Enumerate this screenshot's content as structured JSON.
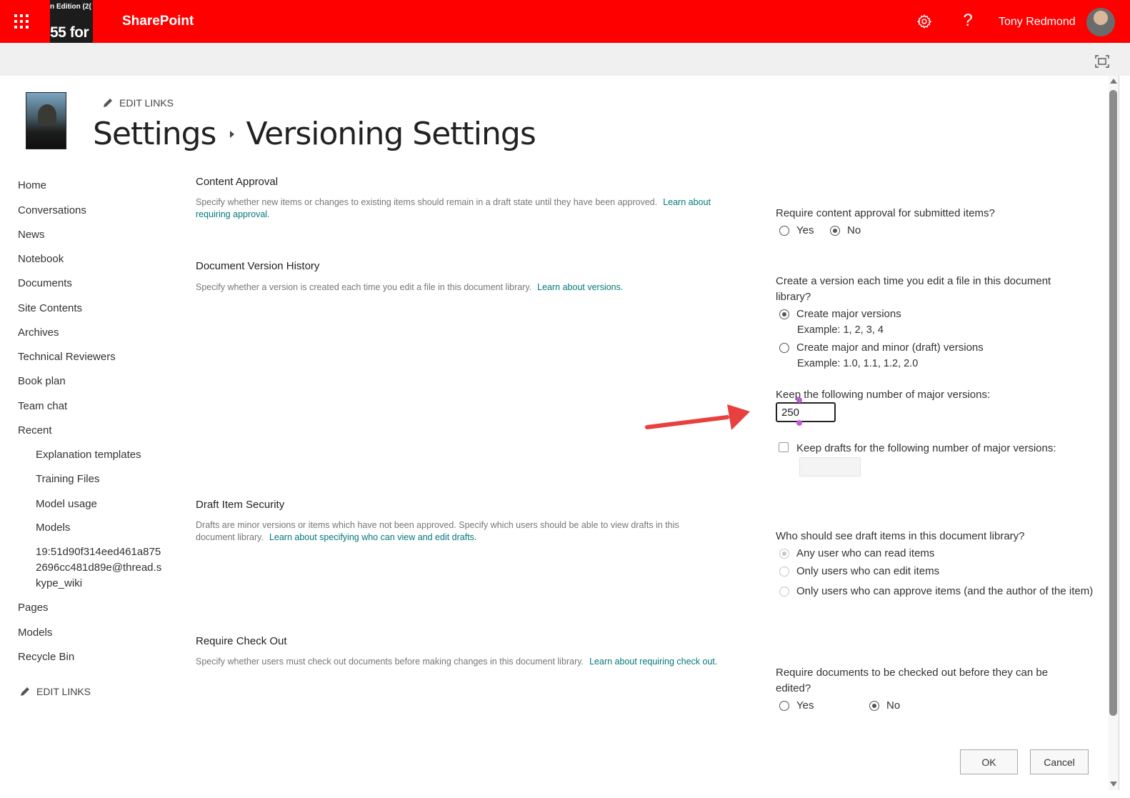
{
  "suitebar": {
    "brand_thumb_line1": "n Edition (2(",
    "brand_thumb_line2": "55 for",
    "app_name": "SharePoint",
    "help_glyph": "?",
    "user_name": "Tony Redmond",
    "accent_color": "#ff0000"
  },
  "header": {
    "edit_links": "EDIT LINKS",
    "breadcrumb_parent": "Settings",
    "breadcrumb_current": "Versioning Settings"
  },
  "leftnav": {
    "items": [
      "Home",
      "Conversations",
      "News",
      "Notebook",
      "Documents",
      "Site Contents",
      "Archives",
      "Technical Reviewers",
      "Book plan",
      "Team chat",
      "Recent"
    ],
    "recent_items": [
      "Explanation templates",
      "Training Files",
      "Model usage",
      "Models",
      "19:51d90f314eed461a8752696cc481d89e@thread.skype_wiki"
    ],
    "items_after": [
      "Pages",
      "Models",
      "Recycle Bin"
    ],
    "edit_links": "EDIT LINKS"
  },
  "content_approval": {
    "title": "Content Approval",
    "desc": "Specify whether new items or changes to existing items should remain in a draft state until they have been approved.",
    "learn": "Learn about requiring approval.",
    "question": "Require content approval for submitted items?",
    "yes": "Yes",
    "no": "No",
    "selected": "No"
  },
  "version_history": {
    "title": "Document Version History",
    "desc": "Specify whether a version is created each time you edit a file in this document library.",
    "learn": "Learn about versions.",
    "question": "Create a version each time you edit a file in this document library?",
    "option_major": "Create major versions",
    "example_major": "Example: 1, 2, 3, 4",
    "option_minor": "Create major and minor (draft) versions",
    "example_minor": "Example: 1.0, 1.1, 1.2, 2.0",
    "keep_label": "Keep the following number of major versions:",
    "keep_value": "250",
    "keep_drafts_label": "Keep drafts for the following number of major versions:",
    "keep_drafts_checked": false
  },
  "draft_security": {
    "title": "Draft Item Security",
    "desc": "Drafts are minor versions or items which have not been approved. Specify which users should be able to view drafts in this document library.",
    "learn": "Learn about specifying who can view and edit drafts.",
    "question": "Who should see draft items in this document library?",
    "opt_read": "Any user who can read items",
    "opt_edit": "Only users who can edit items",
    "opt_approve": "Only users who can approve items (and the author of the item)"
  },
  "checkout": {
    "title": "Require Check Out",
    "desc": "Specify whether users must check out documents before making changes in this document library.",
    "learn": "Learn about requiring check out.",
    "question": "Require documents to be checked out before they can be edited?",
    "yes": "Yes",
    "no": "No",
    "selected": "No"
  },
  "buttons": {
    "ok": "OK",
    "cancel": "Cancel"
  },
  "annotation_arrow_color": "#e8403f"
}
